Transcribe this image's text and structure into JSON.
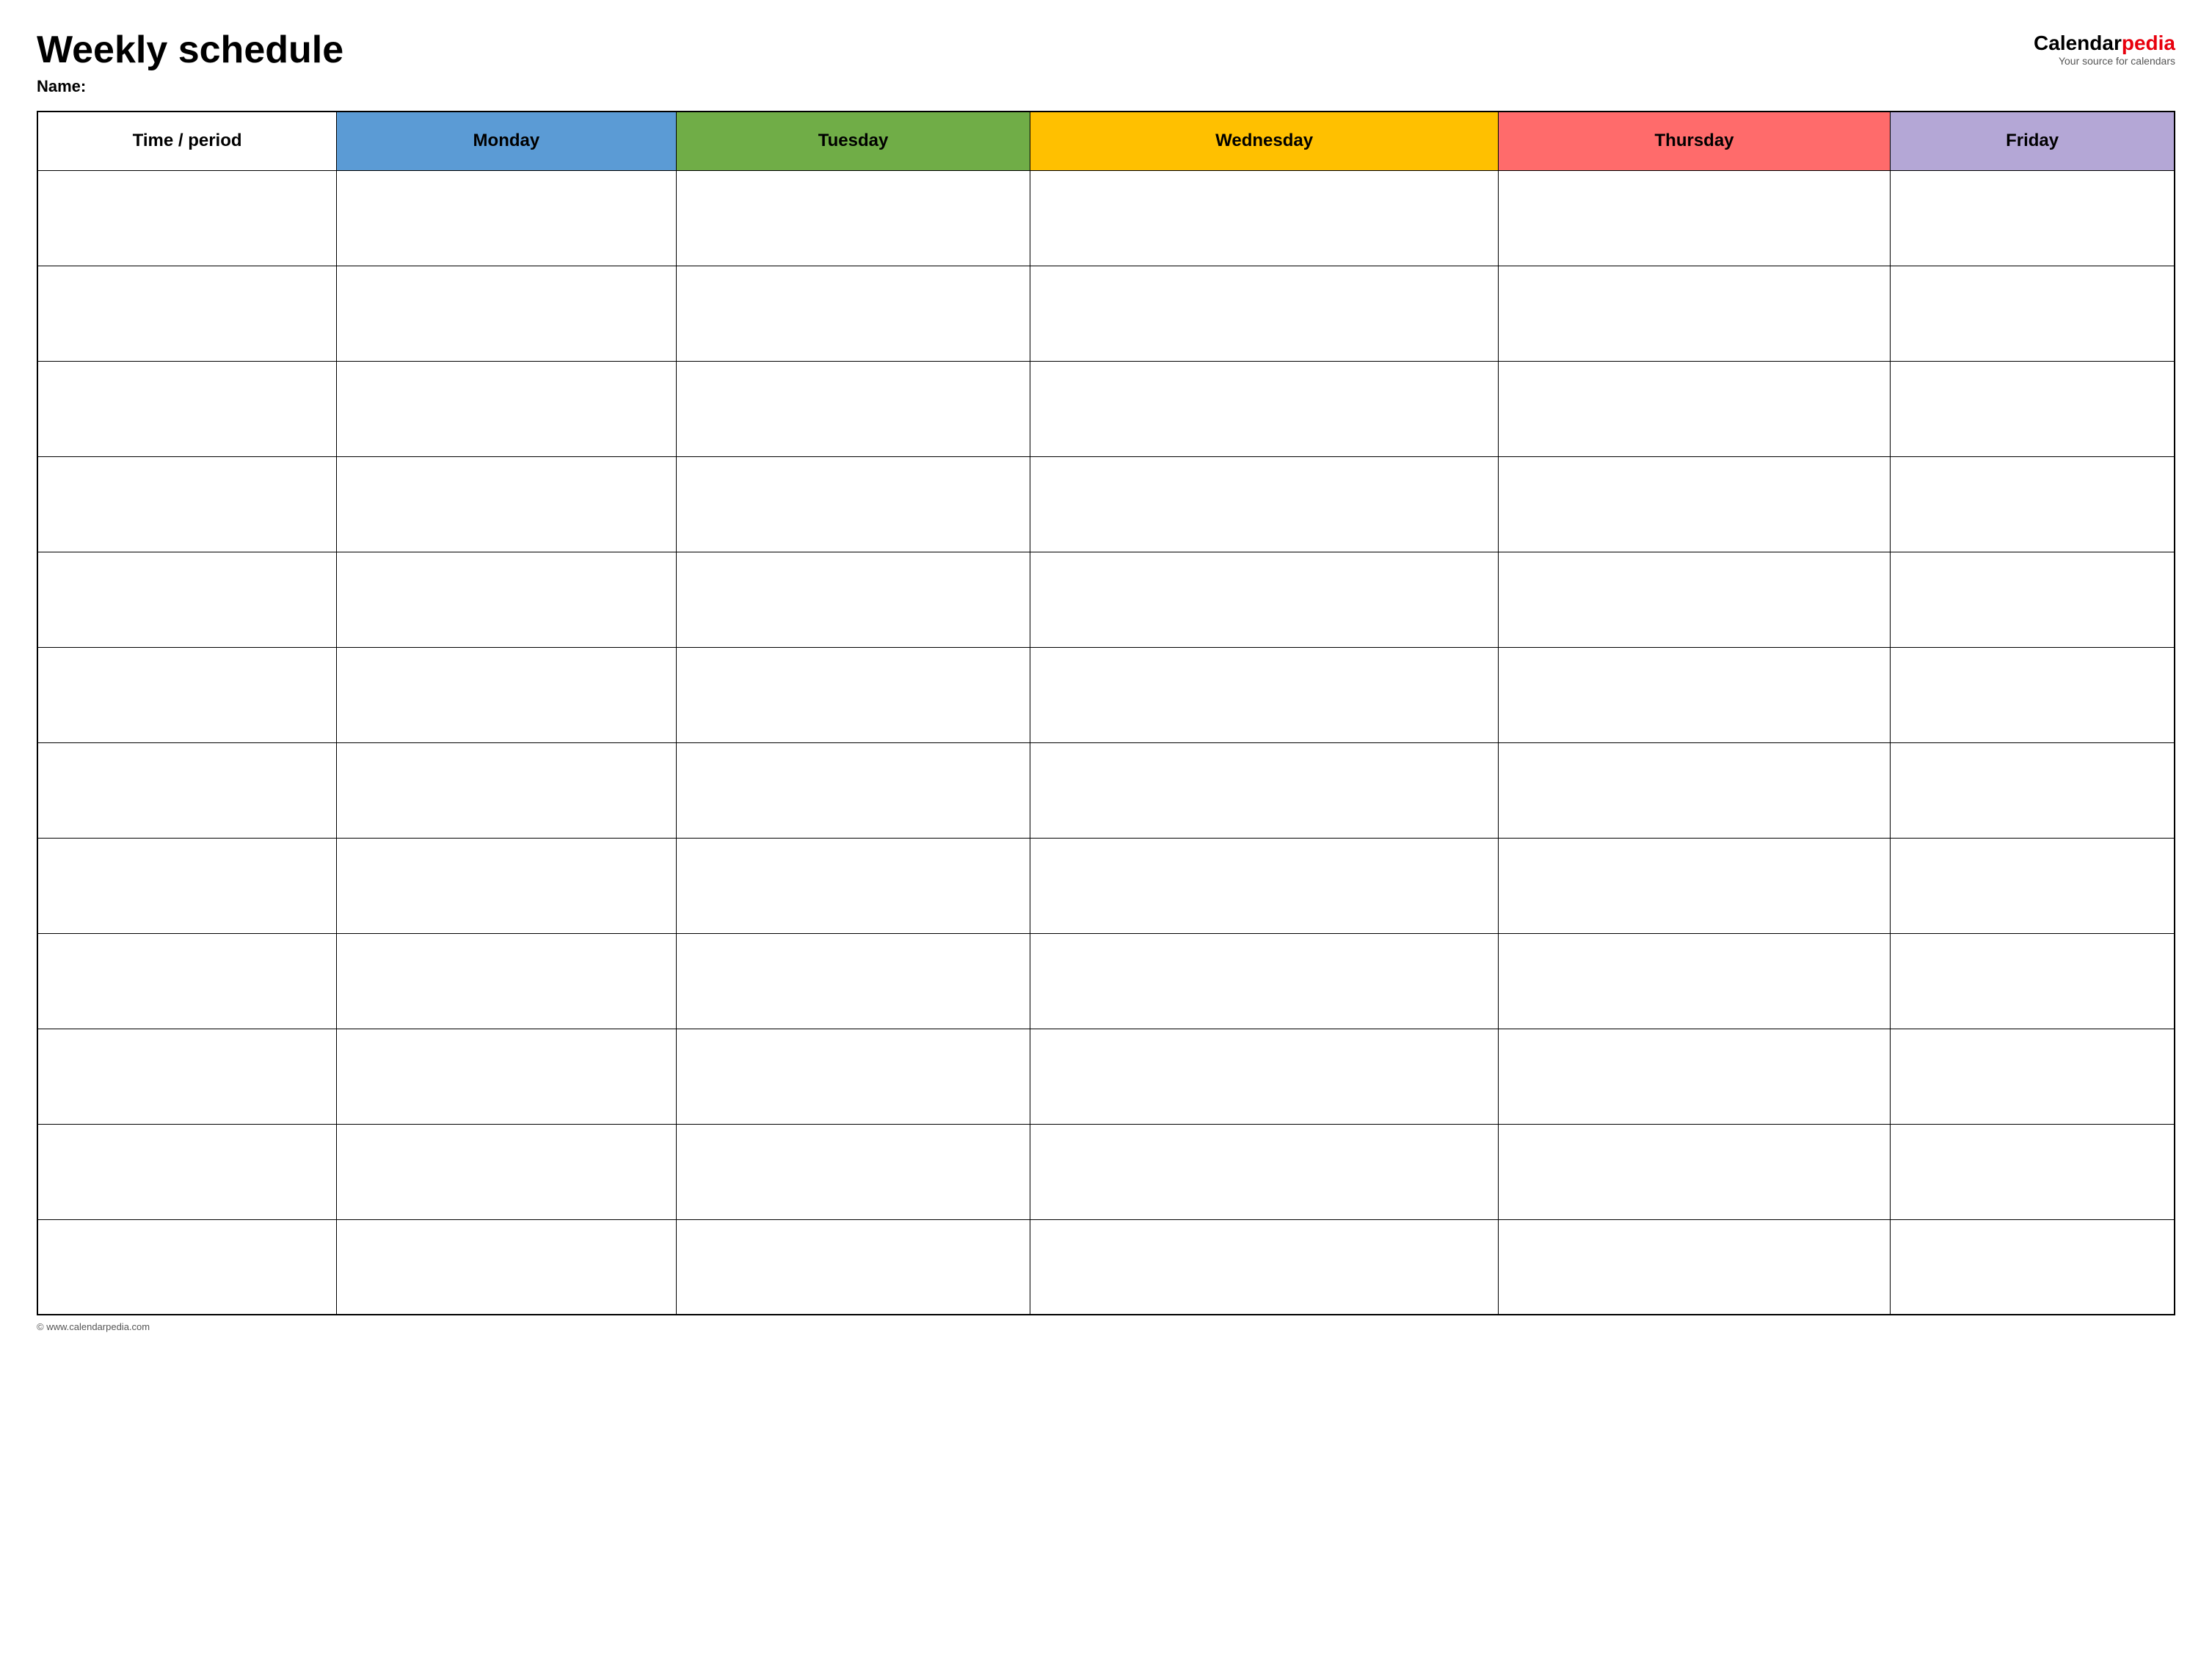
{
  "header": {
    "title": "Weekly schedule",
    "name_label": "Name:",
    "logo": {
      "brand1": "Calendar",
      "brand2": "pedia",
      "tagline": "Your source for calendars"
    }
  },
  "table": {
    "columns": [
      {
        "id": "time",
        "label": "Time / period",
        "color": "#ffffff"
      },
      {
        "id": "monday",
        "label": "Monday",
        "color": "#5b9bd5"
      },
      {
        "id": "tuesday",
        "label": "Tuesday",
        "color": "#70ad47"
      },
      {
        "id": "wednesday",
        "label": "Wednesday",
        "color": "#ffc000"
      },
      {
        "id": "thursday",
        "label": "Thursday",
        "color": "#ff6b6b"
      },
      {
        "id": "friday",
        "label": "Friday",
        "color": "#b4a7d6"
      }
    ],
    "row_count": 12
  },
  "footer": {
    "url": "© www.calendarpedia.com"
  }
}
